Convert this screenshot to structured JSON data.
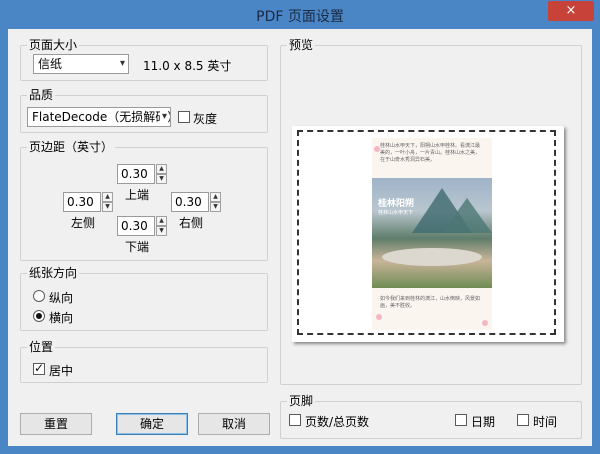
{
  "window": {
    "title": "PDF 页面设置",
    "close_icon": "×"
  },
  "page_size": {
    "legend": "页面大小",
    "selected": "信纸",
    "dimensions": "11.0 x 8.5 英寸"
  },
  "quality": {
    "legend": "品质",
    "selected": "FlateDecode（无损解码）",
    "grayscale_label": "灰度",
    "grayscale_checked": false
  },
  "margins": {
    "legend": "页边距（英寸）",
    "top": {
      "label": "上端",
      "value": "0.30"
    },
    "left": {
      "label": "左侧",
      "value": "0.30"
    },
    "right": {
      "label": "右侧",
      "value": "0.30"
    },
    "bottom": {
      "label": "下端",
      "value": "0.30"
    }
  },
  "orientation": {
    "legend": "纸张方向",
    "portrait": "纵向",
    "landscape": "横向",
    "selected": "landscape"
  },
  "position": {
    "legend": "位置",
    "center_label": "居中",
    "center_checked": true
  },
  "buttons": {
    "reset": "重置",
    "ok": "确定",
    "cancel": "取消"
  },
  "preview": {
    "legend": "预览",
    "thumb_text_top": "桂林山水甲天下，阳朔山水甲桂林。看漓江最美的，一叶小舟，一片青山。桂林山水之美，在于山奇水秀洞异石美。",
    "thumb_title": "桂林阳朔",
    "thumb_subtitle": "桂林山水甲天下",
    "thumb_text_bottom": "如今我们来到桂林的漓江，山水倒映，风景如画，美不胜收。"
  },
  "footer": {
    "legend": "页脚",
    "page_count": "页数/总页数",
    "date": "日期",
    "time": "时间"
  }
}
